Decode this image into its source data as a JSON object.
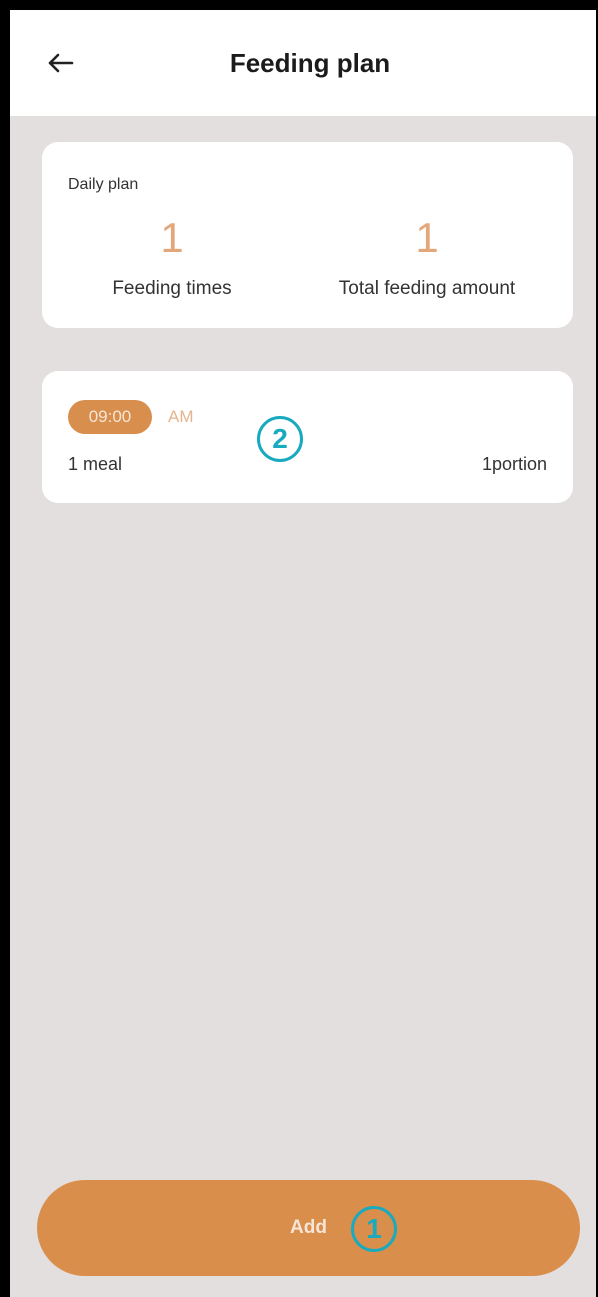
{
  "header": {
    "title": "Feeding plan",
    "back_icon": "arrow-left-icon"
  },
  "daily_plan": {
    "label": "Daily plan",
    "feeding_times": {
      "value": "1",
      "label": "Feeding times"
    },
    "total_amount": {
      "value": "1",
      "label": "Total feeding amount"
    }
  },
  "meals": [
    {
      "time": "09:00",
      "period": "AM",
      "name": "1 meal",
      "portion": "1portion"
    }
  ],
  "footer": {
    "add_label": "Add"
  },
  "annotations": {
    "marker_1": "1",
    "marker_2": "2"
  },
  "colors": {
    "accent": "#d98e4c",
    "value_text": "#e3a77a",
    "background": "#e3dfdf",
    "annotation": "#18aabf"
  }
}
